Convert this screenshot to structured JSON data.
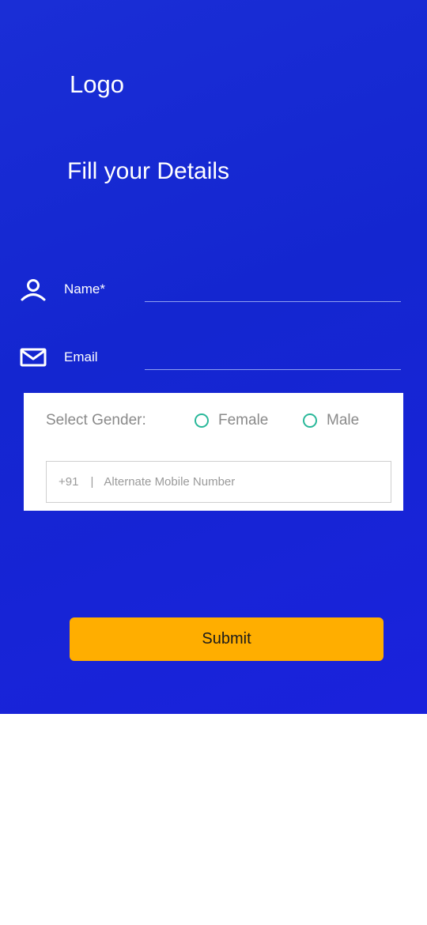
{
  "header": {
    "logo_text": "Logo",
    "title": "Fill your Details"
  },
  "form": {
    "name": {
      "label": "Name*",
      "icon": "user-icon",
      "value": ""
    },
    "email": {
      "label": "Email",
      "icon": "mail-icon",
      "value": ""
    },
    "gender": {
      "label": "Select Gender:",
      "options": [
        "Female",
        "Male"
      ],
      "selected": ""
    },
    "phone": {
      "prefix": "+91",
      "separator": "|",
      "placeholder": "Alternate Mobile Number",
      "value": ""
    },
    "submit_label": "Submit"
  },
  "colors": {
    "panel_blue": "#1426d0",
    "accent_yellow": "#ffae00",
    "radio_teal": "#2ab89a"
  }
}
